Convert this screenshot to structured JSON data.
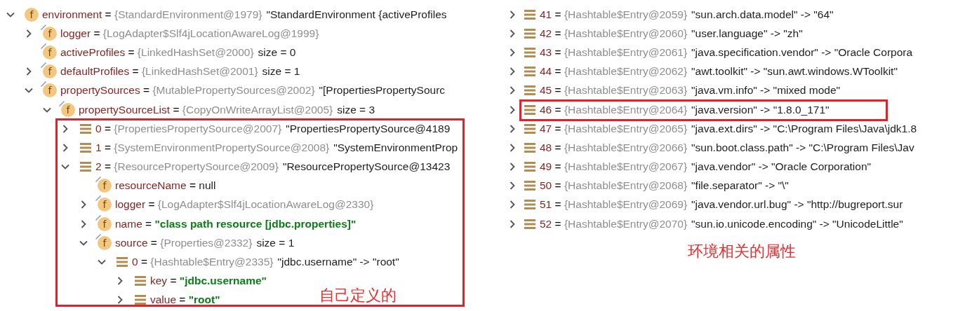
{
  "variables_tree": [
    {
      "kind": "field",
      "badge": "f",
      "pinned": false,
      "expandable": true,
      "expanded": true,
      "name": "environment",
      "equals": "=",
      "type": "{StandardEnvironment@1979}",
      "value": "\"StandardEnvironment {activeProfiles",
      "is_string": false,
      "children": [
        {
          "kind": "field",
          "badge": "f",
          "pinned": true,
          "expandable": true,
          "expanded": false,
          "name": "logger",
          "equals": "=",
          "type": "{LogAdapter$Slf4jLocationAwareLog@1999}"
        },
        {
          "kind": "field",
          "badge": "f",
          "pinned": true,
          "expandable": false,
          "name": "activeProfiles",
          "equals": "=",
          "type": "{LinkedHashSet@2000}",
          "value": "size = 0",
          "is_string": false
        },
        {
          "kind": "field",
          "badge": "f",
          "pinned": true,
          "expandable": true,
          "expanded": false,
          "name": "defaultProfiles",
          "equals": "=",
          "type": "{LinkedHashSet@2001}",
          "value": "size = 1",
          "is_string": false
        },
        {
          "kind": "field",
          "badge": "f",
          "pinned": true,
          "expandable": true,
          "expanded": true,
          "name": "propertySources",
          "equals": "=",
          "type": "{MutablePropertySources@2002}",
          "value": "\"[PropertiesPropertySourc",
          "is_string": false,
          "children": [
            {
              "kind": "field",
              "badge": "f",
              "pinned": true,
              "expandable": true,
              "expanded": true,
              "name": "propertySourceList",
              "equals": "=",
              "type": "{CopyOnWriteArrayList@2005}",
              "value": "size = 3",
              "is_string": false,
              "children": [
                {
                  "kind": "entry",
                  "expandable": true,
                  "expanded": false,
                  "name": "0",
                  "equals": "=",
                  "type": "{PropertiesPropertySource@2007}",
                  "value": "\"PropertiesPropertySource@4189",
                  "is_string": false
                },
                {
                  "kind": "entry",
                  "expandable": true,
                  "expanded": false,
                  "name": "1",
                  "equals": "=",
                  "type": "{SystemEnvironmentPropertySource@2008}",
                  "value": "\"SystemEnvironmentProp",
                  "is_string": false
                },
                {
                  "kind": "entry",
                  "expandable": true,
                  "expanded": true,
                  "name": "2",
                  "equals": "=",
                  "type": "{ResourcePropertySource@2009}",
                  "value": "\"ResourcePropertySource@13423",
                  "is_string": false,
                  "children": [
                    {
                      "kind": "field",
                      "badge": "f",
                      "pinned": true,
                      "expandable": false,
                      "name": "resourceName",
                      "equals": "=",
                      "value": "null",
                      "is_string": false
                    },
                    {
                      "kind": "field",
                      "badge": "f",
                      "pinned": true,
                      "expandable": true,
                      "expanded": false,
                      "name": "logger",
                      "equals": "=",
                      "type": "{LogAdapter$Slf4jLocationAwareLog@2330}"
                    },
                    {
                      "kind": "field",
                      "badge": "f",
                      "pinned": true,
                      "expandable": true,
                      "expanded": false,
                      "name": "name",
                      "equals": "=",
                      "value": "\"class path resource [jdbc.properties]\"",
                      "is_string": true
                    },
                    {
                      "kind": "field",
                      "badge": "f",
                      "pinned": true,
                      "expandable": true,
                      "expanded": true,
                      "name": "source",
                      "equals": "=",
                      "type": "{Properties@2332}",
                      "value": "size = 1",
                      "is_string": false,
                      "children": [
                        {
                          "kind": "entry",
                          "expandable": true,
                          "expanded": true,
                          "name": "0",
                          "equals": "=",
                          "type": "{Hashtable$Entry@2335}",
                          "value": "\"jdbc.username\" -> \"root\"",
                          "is_string": false,
                          "children": [
                            {
                              "kind": "entry",
                              "expandable": true,
                              "expanded": false,
                              "name": "key",
                              "equals": "=",
                              "value": "\"jdbc.username\"",
                              "is_string": true
                            },
                            {
                              "kind": "entry",
                              "expandable": true,
                              "expanded": false,
                              "name": "value",
                              "equals": "=",
                              "value": "\"root\"",
                              "is_string": true
                            }
                          ]
                        }
                      ]
                    }
                  ]
                }
              ]
            }
          ]
        }
      ]
    }
  ],
  "entries_list": [
    {
      "kind": "entry",
      "expandable": true,
      "expanded": false,
      "highlighted": false,
      "name": "41",
      "equals": "=",
      "type": "{Hashtable$Entry@2059}",
      "value": "\"sun.arch.data.model\" -> \"64\"",
      "is_string": false
    },
    {
      "kind": "entry",
      "expandable": true,
      "expanded": false,
      "highlighted": false,
      "name": "42",
      "equals": "=",
      "type": "{Hashtable$Entry@2060}",
      "value": "\"user.language\" -> \"zh\"",
      "is_string": false
    },
    {
      "kind": "entry",
      "expandable": true,
      "expanded": false,
      "highlighted": false,
      "name": "43",
      "equals": "=",
      "type": "{Hashtable$Entry@2061}",
      "value": "\"java.specification.vendor\" -> \"Oracle Corpora",
      "is_string": false
    },
    {
      "kind": "entry",
      "expandable": true,
      "expanded": false,
      "highlighted": false,
      "name": "44",
      "equals": "=",
      "type": "{Hashtable$Entry@2062}",
      "value": "\"awt.toolkit\" -> \"sun.awt.windows.WToolkit\"",
      "is_string": false
    },
    {
      "kind": "entry",
      "expandable": true,
      "expanded": false,
      "highlighted": false,
      "name": "45",
      "equals": "=",
      "type": "{Hashtable$Entry@2063}",
      "value": "\"java.vm.info\" -> \"mixed mode\"",
      "is_string": false
    },
    {
      "kind": "entry",
      "expandable": true,
      "expanded": false,
      "highlighted": true,
      "name": "46",
      "equals": "=",
      "type": "{Hashtable$Entry@2064}",
      "value": "\"java.version\" -> \"1.8.0_171\"",
      "is_string": false
    },
    {
      "kind": "entry",
      "expandable": true,
      "expanded": false,
      "highlighted": false,
      "name": "47",
      "equals": "=",
      "type": "{Hashtable$Entry@2065}",
      "value": "\"java.ext.dirs\" -> \"C:\\Program Files\\Java\\jdk1.8",
      "is_string": false
    },
    {
      "kind": "entry",
      "expandable": true,
      "expanded": false,
      "highlighted": false,
      "name": "48",
      "equals": "=",
      "type": "{Hashtable$Entry@2066}",
      "value": "\"sun.boot.class.path\" -> \"C:\\Program Files\\Jav",
      "is_string": false
    },
    {
      "kind": "entry",
      "expandable": true,
      "expanded": false,
      "highlighted": false,
      "name": "49",
      "equals": "=",
      "type": "{Hashtable$Entry@2067}",
      "value": "\"java.vendor\" -> \"Oracle Corporation\"",
      "is_string": false
    },
    {
      "kind": "entry",
      "expandable": true,
      "expanded": false,
      "highlighted": false,
      "name": "50",
      "equals": "=",
      "type": "{Hashtable$Entry@2068}",
      "value": "\"file.separator\" -> \"\\\"",
      "is_string": false
    },
    {
      "kind": "entry",
      "expandable": true,
      "expanded": false,
      "highlighted": false,
      "name": "51",
      "equals": "=",
      "type": "{Hashtable$Entry@2069}",
      "value": "\"java.vendor.url.bug\" -> \"http://bugreport.sur",
      "is_string": false
    },
    {
      "kind": "entry",
      "expandable": true,
      "expanded": false,
      "highlighted": false,
      "name": "52",
      "equals": "=",
      "type": "{Hashtable$Entry@2070}",
      "value": "\"sun.io.unicode.encoding\" -> \"UnicodeLittle\"",
      "is_string": false
    }
  ],
  "annotations": [
    {
      "text": "自己定义的"
    },
    {
      "text": "环境相关的属性"
    }
  ]
}
